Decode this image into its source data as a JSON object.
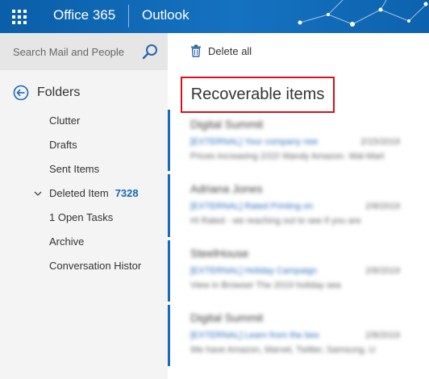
{
  "header": {
    "brand": "Office 365",
    "app": "Outlook"
  },
  "search": {
    "placeholder": "Search Mail and People"
  },
  "toolbar": {
    "delete_all_label": "Delete all"
  },
  "folders": {
    "heading": "Folders",
    "items": [
      {
        "label": "Clutter"
      },
      {
        "label": "Drafts"
      },
      {
        "label": "Sent Items"
      },
      {
        "label": "Deleted Item",
        "count": "7328"
      },
      {
        "label": "1 Open Tasks"
      },
      {
        "label": "Archive"
      },
      {
        "label": "Conversation Histor"
      }
    ]
  },
  "main": {
    "title": "Recoverable items",
    "messages": [
      {
        "sender": "Digital Summit",
        "subject": "[EXTERNAL] Your company nee",
        "date": "2/15/2019",
        "preview": "Prices increasing 2/22! Mandy Amazon. Wal-Mart"
      },
      {
        "sender": "Adriana Jones",
        "subject": "[EXTERNAL] Rated Printing on",
        "date": "2/8/2019",
        "preview": "Hi Rated - we reaching out to see if you are"
      },
      {
        "sender": "SteelHouse",
        "subject": "[EXTERNAL] Holiday Campaign",
        "date": "2/8/2019",
        "preview": "View in Browser          The 2019 holiday sea"
      },
      {
        "sender": "Digital Summit",
        "subject": "[EXTERNAL] Learn from the bes",
        "date": "2/8/2019",
        "preview": "We have Amazon, Marvel, Twitter, Samsung, U"
      }
    ]
  },
  "colors": {
    "header_bg": "#1572c1",
    "accent": "#1a67b4",
    "highlight_border": "#d9101a"
  }
}
